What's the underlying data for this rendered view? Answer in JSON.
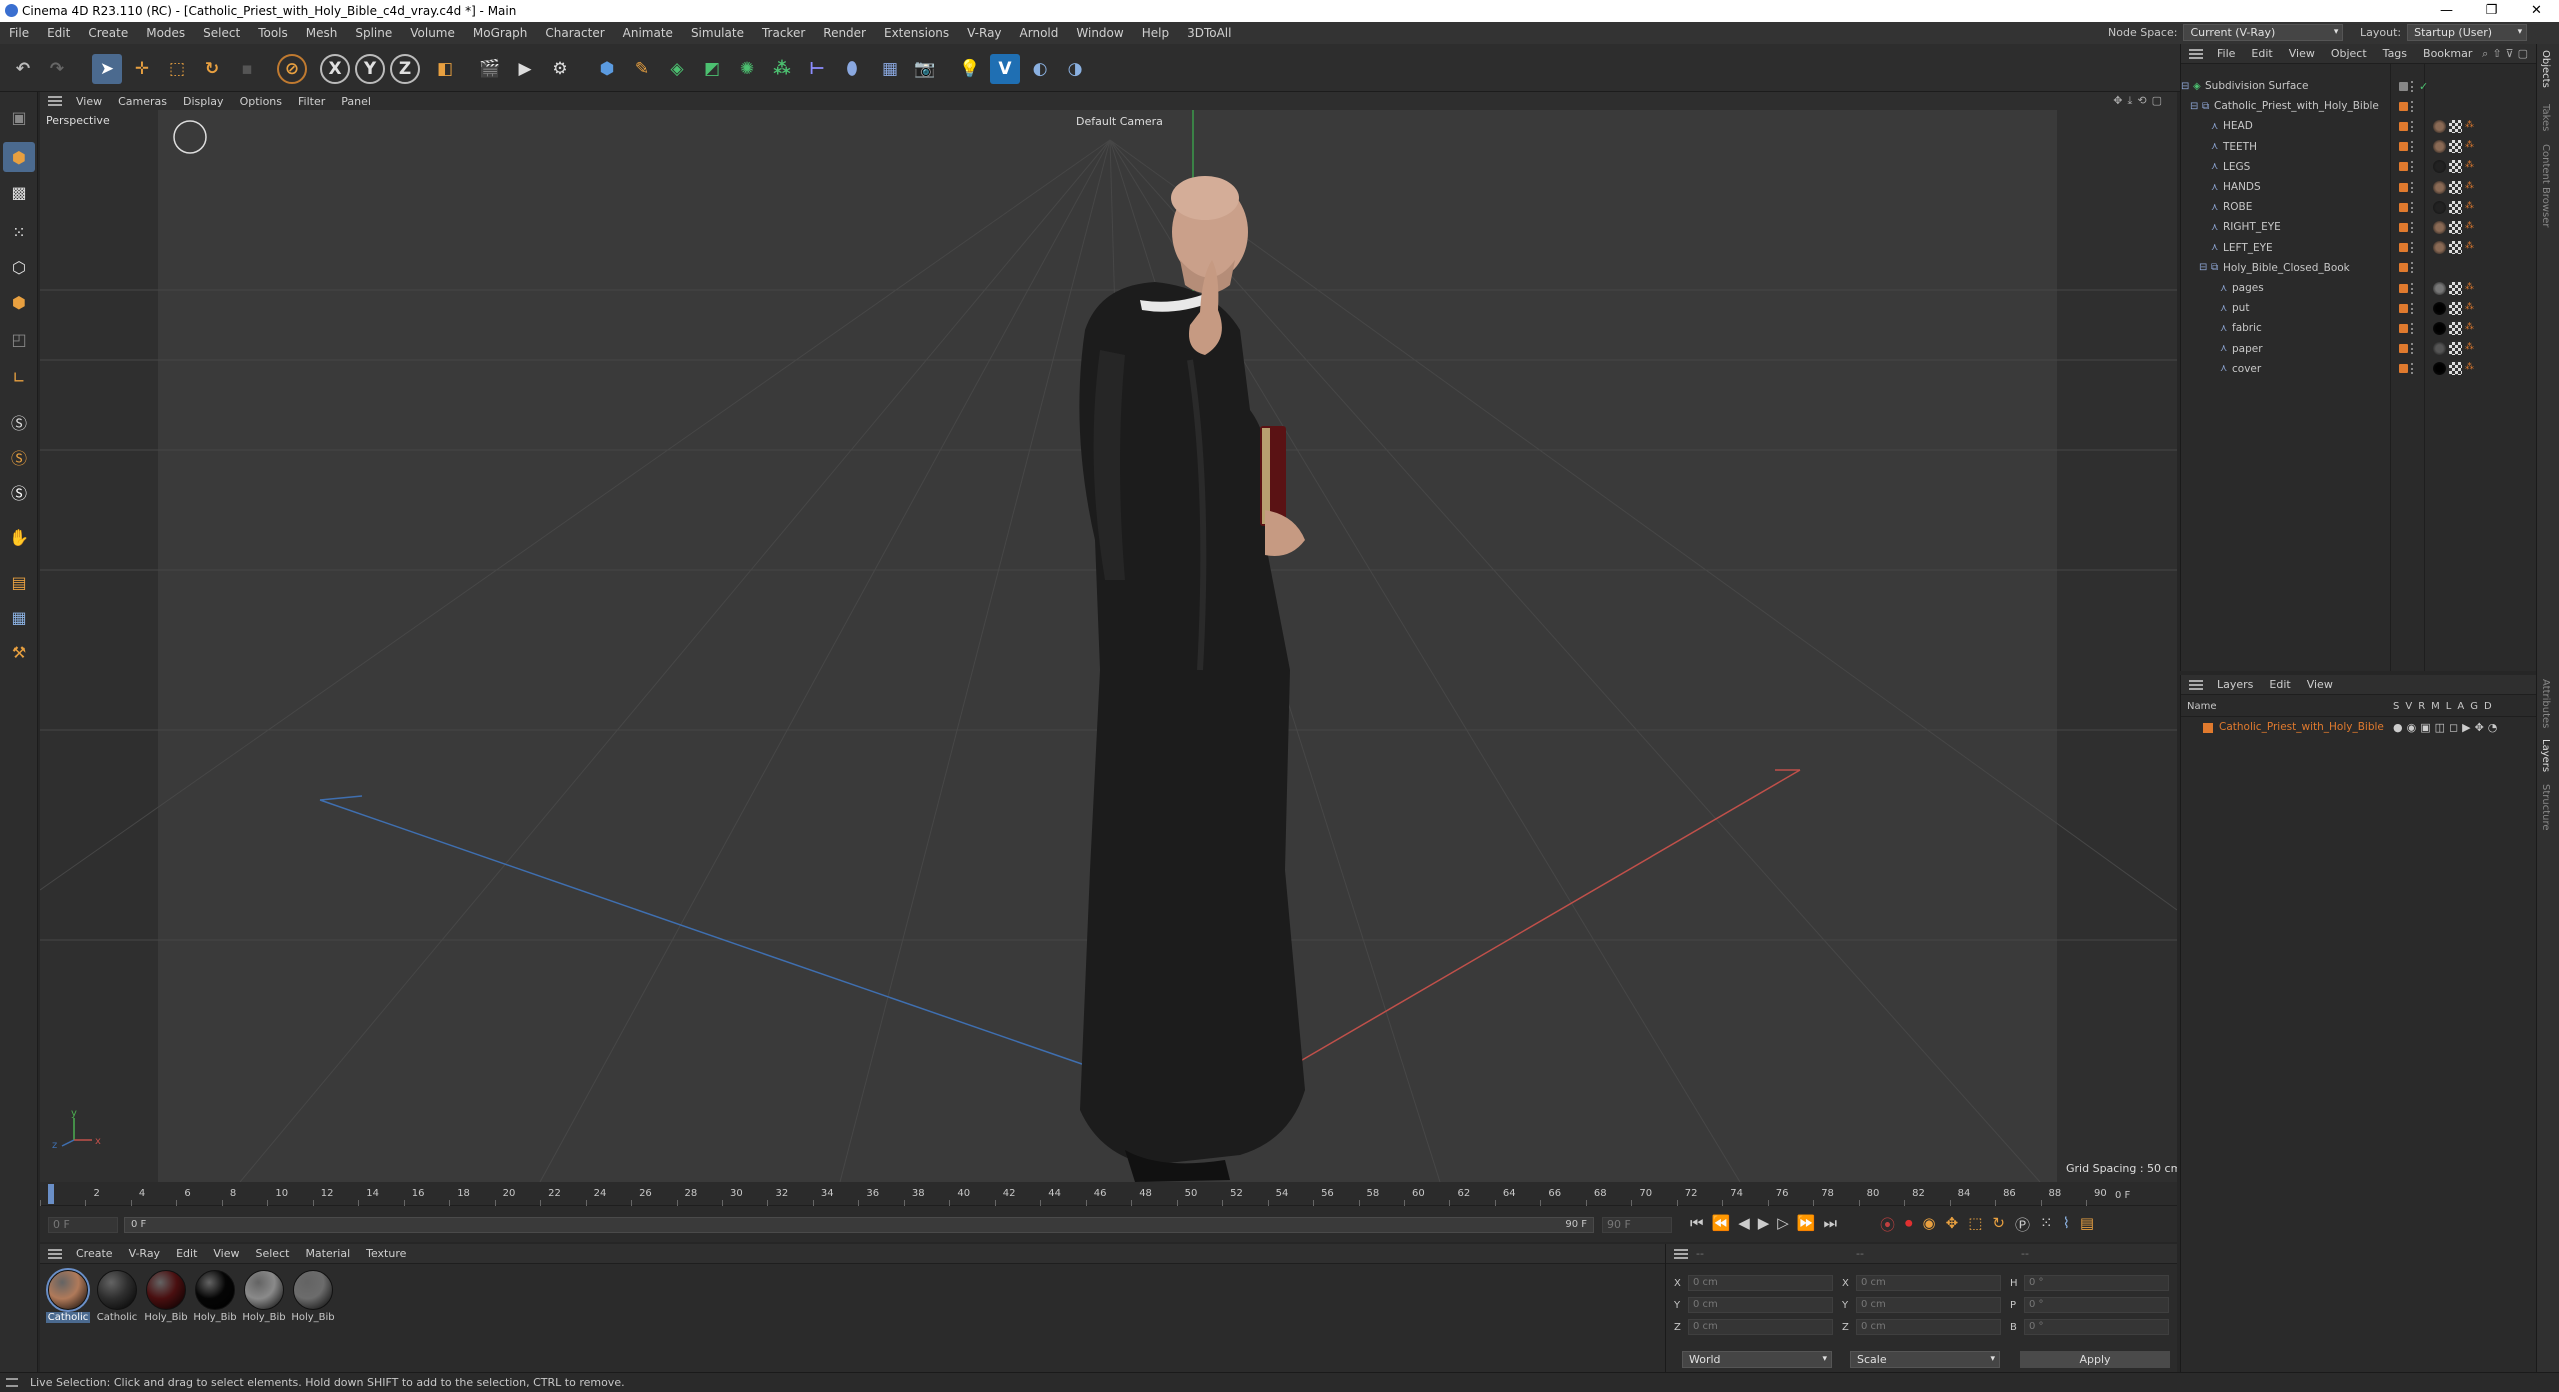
{
  "window": {
    "title": "Cinema 4D R23.110 (RC) - [Catholic_Priest_with_Holy_Bible_c4d_vray.c4d *] - Main",
    "controls": [
      "—",
      "❐",
      "✕"
    ]
  },
  "menubar": {
    "items": [
      "File",
      "Edit",
      "Create",
      "Modes",
      "Select",
      "Tools",
      "Mesh",
      "Spline",
      "Volume",
      "MoGraph",
      "Character",
      "Animate",
      "Simulate",
      "Tracker",
      "Render",
      "Extensions",
      "V-Ray",
      "Arnold",
      "Window",
      "Help",
      "3DToAll"
    ],
    "node_space_label": "Node Space:",
    "node_space_value": "Current (V-Ray)",
    "layout_label": "Layout:",
    "layout_value": "Startup (User)"
  },
  "viewport": {
    "menu": [
      "View",
      "Cameras",
      "Display",
      "Options",
      "Filter",
      "Panel"
    ],
    "view_name": "Perspective",
    "camera": "Default Camera",
    "grid_spacing": "Grid Spacing : 50 cm",
    "axis_labels": {
      "y": "y",
      "z": "z",
      "x": "x"
    }
  },
  "timeline": {
    "ticks": [
      "0",
      "2",
      "4",
      "6",
      "8",
      "10",
      "12",
      "14",
      "16",
      "18",
      "20",
      "22",
      "24",
      "26",
      "28",
      "30",
      "32",
      "34",
      "36",
      "38",
      "40",
      "42",
      "44",
      "46",
      "48",
      "50",
      "52",
      "54",
      "56",
      "58",
      "60",
      "62",
      "64",
      "66",
      "68",
      "70",
      "72",
      "74",
      "76",
      "78",
      "80",
      "82",
      "84",
      "86",
      "88",
      "90"
    ],
    "frame_end_label": "0 F",
    "current": "0 F",
    "start": "0 F",
    "range_end": "90 F",
    "end": "90 F"
  },
  "materials": {
    "menu": [
      "Create",
      "V-Ray",
      "Edit",
      "View",
      "Select",
      "Material",
      "Texture"
    ],
    "items": [
      {
        "label": "Catholic",
        "color": "#b07a5a"
      },
      {
        "label": "Catholic",
        "color": "#2e2e2e"
      },
      {
        "label": "Holy_Bib",
        "color": "#4a0f10"
      },
      {
        "label": "Holy_Bib",
        "color": "#050505"
      },
      {
        "label": "Holy_Bib",
        "color": "#8a8a8a"
      },
      {
        "label": "Holy_Bib",
        "color": "#6c6c6c"
      }
    ]
  },
  "coordinates": {
    "header": [
      "--",
      "--",
      "--"
    ],
    "rows": [
      {
        "a": "X",
        "av": "0 cm",
        "b": "X",
        "bv": "0 cm",
        "c": "H",
        "cv": "0 °"
      },
      {
        "a": "Y",
        "av": "0 cm",
        "b": "Y",
        "bv": "0 cm",
        "c": "P",
        "cv": "0 °"
      },
      {
        "a": "Z",
        "av": "0 cm",
        "b": "Z",
        "bv": "0 cm",
        "c": "B",
        "cv": "0 °"
      }
    ],
    "world": "World",
    "scale": "Scale",
    "apply": "Apply"
  },
  "objects": {
    "menu": [
      "File",
      "Edit",
      "View",
      "Object",
      "Tags",
      "Bookmar"
    ],
    "tree": [
      {
        "name": "Subdivision Surface",
        "level": 0
      },
      {
        "name": "Catholic_Priest_with_Holy_Bible",
        "level": 1
      },
      {
        "name": "HEAD",
        "level": 2
      },
      {
        "name": "TEETH",
        "level": 2
      },
      {
        "name": "LEGS",
        "level": 2
      },
      {
        "name": "HANDS",
        "level": 2
      },
      {
        "name": "ROBE",
        "level": 2
      },
      {
        "name": "RIGHT_EYE",
        "level": 2
      },
      {
        "name": "LEFT_EYE",
        "level": 2
      },
      {
        "name": "Holy_Bible_Closed_Book",
        "level": 2
      },
      {
        "name": "pages",
        "level": 3
      },
      {
        "name": "put",
        "level": 3
      },
      {
        "name": "fabric",
        "level": 3
      },
      {
        "name": "paper",
        "level": 3
      },
      {
        "name": "cover",
        "level": 3
      }
    ]
  },
  "layers": {
    "menu": [
      "Layers",
      "Edit",
      "View"
    ],
    "columns": {
      "name": "Name",
      "flags": [
        "S",
        "V",
        "R",
        "M",
        "L",
        "A",
        "G",
        "D"
      ]
    },
    "rows": [
      {
        "name": "Catholic_Priest_with_Holy_Bible",
        "color": "#e07a2e"
      }
    ]
  },
  "right_tabs": [
    "Objects",
    "Takes",
    "Content Browser",
    "Attributes",
    "Layers",
    "Structure"
  ],
  "status": "Live Selection: Click and drag to select elements. Hold down SHIFT to add to the selection, CTRL to remove.",
  "colors": {
    "accent": "#e07a2e",
    "x_axis": "#c0504a",
    "z_axis": "#3f6fb0",
    "y_axis": "#4caf50"
  }
}
